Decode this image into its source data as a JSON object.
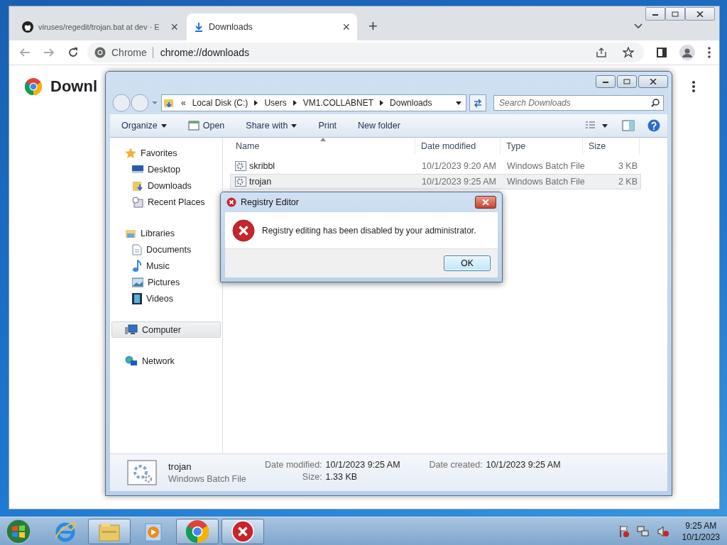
{
  "chrome": {
    "tabs": [
      {
        "title": "viruses/regedit/trojan.bat at dev · E",
        "kind": "github",
        "selected": false,
        "close": "×"
      },
      {
        "title": "Downloads",
        "kind": "download",
        "selected": true,
        "close": "×"
      }
    ],
    "new_tab": "+",
    "address": {
      "site": "Chrome",
      "url": "chrome://downloads"
    },
    "page_title": "Downl"
  },
  "explorer": {
    "address": {
      "overflow": "«",
      "path": [
        "Local Disk (C:)",
        "Users",
        "VM1.COLLABNET",
        "Downloads"
      ]
    },
    "search": {
      "placeholder": "Search Downloads"
    },
    "toolbar": [
      {
        "label": "Organize",
        "kind": "menu"
      },
      {
        "label": "Open",
        "kind": "icon"
      },
      {
        "label": "Share with",
        "kind": "menu"
      },
      {
        "label": "Print",
        "kind": "plain"
      },
      {
        "label": "New folder",
        "kind": "plain"
      }
    ],
    "nav": [
      {
        "label": "Favorites",
        "kind": "star",
        "selected": false,
        "children": [
          {
            "label": "Desktop",
            "kind": "desktop",
            "selected": false
          },
          {
            "label": "Downloads",
            "kind": "folder",
            "selected": false
          },
          {
            "label": "Recent Places",
            "kind": "recent",
            "selected": false
          }
        ]
      },
      {
        "label": "Libraries",
        "kind": "library",
        "selected": false,
        "children": [
          {
            "label": "Documents",
            "kind": "document",
            "selected": false
          },
          {
            "label": "Music",
            "kind": "music",
            "selected": false
          },
          {
            "label": "Pictures",
            "kind": "pictures",
            "selected": false
          },
          {
            "label": "Videos",
            "kind": "video",
            "selected": false
          }
        ]
      },
      {
        "label": "Computer",
        "kind": "computer",
        "selected": true
      },
      {
        "label": "Network",
        "kind": "network",
        "selected": false
      }
    ],
    "columns": [
      "Name",
      "Date modified",
      "Type",
      "Size"
    ],
    "files": [
      {
        "name": "skribbl",
        "date": "10/1/2023 9:20 AM",
        "type": "Windows Batch File",
        "size": "3 KB",
        "selected": false
      },
      {
        "name": "trojan",
        "date": "10/1/2023 9:25 AM",
        "type": "Windows Batch File",
        "size": "2 KB",
        "selected": true
      }
    ],
    "details": {
      "name": "trojan",
      "type": "Windows Batch File",
      "fields": [
        {
          "label": "Date modified:",
          "value": "10/1/2023 9:25 AM"
        },
        {
          "label": "Date created:",
          "value": "10/1/2023 9:25 AM"
        },
        {
          "label": "Size:",
          "value": "1.33 KB"
        }
      ]
    }
  },
  "dialog": {
    "title": "Registry Editor",
    "message": "Registry editing has been disabled by your administrator.",
    "button": "OK"
  },
  "taskbar": {
    "apps": [
      {
        "kind": "ie",
        "running": false
      },
      {
        "kind": "explorer",
        "running": true
      },
      {
        "kind": "media",
        "running": false
      },
      {
        "kind": "chrome",
        "running": true
      },
      {
        "kind": "error",
        "running": true
      }
    ],
    "clock": {
      "time": "9:25 AM",
      "date": "10/1/2023"
    }
  }
}
